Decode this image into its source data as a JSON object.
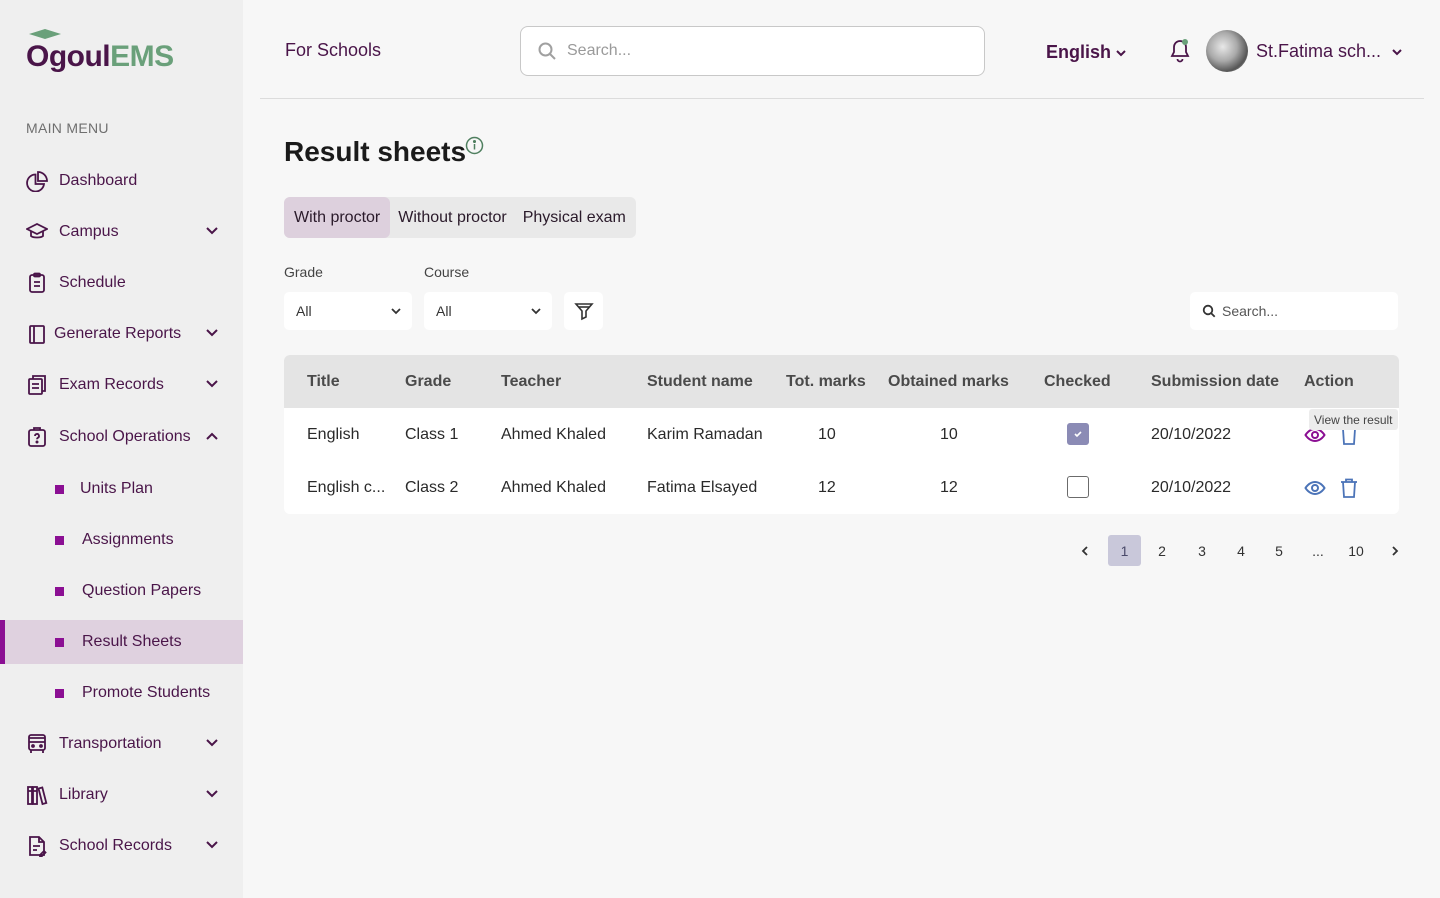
{
  "brand": {
    "logo_part1": "Ogoul",
    "logo_part2": "EMS",
    "accent": "#8b0f93",
    "primary": "#4a1549",
    "logo_green": "#6aa07a"
  },
  "sidebar": {
    "caption": "MAIN MENU",
    "items": [
      {
        "label": "Dashboard",
        "icon": "pie-chart-icon"
      },
      {
        "label": "Campus",
        "icon": "graduation-cap-icon"
      },
      {
        "label": "Schedule",
        "icon": "clipboard-icon"
      },
      {
        "label": "Generate Reports",
        "icon": "book-icon"
      },
      {
        "label": "Exam Records",
        "icon": "documents-icon"
      },
      {
        "label": "School Operations",
        "icon": "question-document-icon"
      },
      {
        "label": "Transportation",
        "icon": "bus-icon"
      },
      {
        "label": "Library",
        "icon": "library-icon"
      },
      {
        "label": "School Records",
        "icon": "records-icon"
      }
    ],
    "sub_items": [
      {
        "label": "Units Plan"
      },
      {
        "label": "Assignments"
      },
      {
        "label": "Question Papers"
      },
      {
        "label": "Result Sheets"
      },
      {
        "label": "Promote Students"
      }
    ],
    "active_sub": "Result Sheets"
  },
  "header": {
    "for_schools": "For Schools",
    "search_placeholder": "Search...",
    "language": "English",
    "user_name": "St.Fatima sch..."
  },
  "page": {
    "title": "Result sheets",
    "tabs": [
      {
        "label": "With proctor",
        "active": true
      },
      {
        "label": "Without proctor",
        "active": false
      },
      {
        "label": "Physical exam",
        "active": false
      }
    ],
    "filters": {
      "grade_label": "Grade",
      "grade_value": "All",
      "course_label": "Course",
      "course_value": "All"
    },
    "table_search_placeholder": "Search..."
  },
  "table": {
    "columns": [
      "Title",
      "Grade",
      "Teacher",
      "Student name",
      "Tot. marks",
      "Obtained marks",
      "Checked",
      "Submission date",
      "Action"
    ],
    "rows": [
      {
        "title": "English",
        "grade": "Class 1",
        "teacher": "Ahmed Khaled",
        "student": "Karim Ramadan",
        "total": "10",
        "obtained": "10",
        "checked": true,
        "date": "20/10/2022"
      },
      {
        "title": "English c...",
        "grade": "Class 2",
        "teacher": "Ahmed Khaled",
        "student": "Fatima Elsayed",
        "total": "12",
        "obtained": "12",
        "checked": false,
        "date": "20/10/2022"
      }
    ],
    "tooltip": "View the result"
  },
  "pagination": {
    "pages": [
      "1",
      "2",
      "3",
      "4",
      "5",
      "...",
      "10"
    ],
    "current": "1"
  }
}
